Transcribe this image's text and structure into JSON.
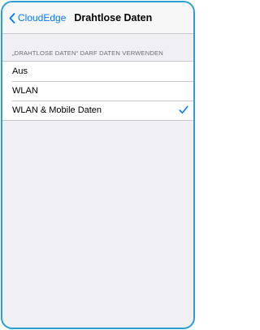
{
  "nav": {
    "back_label": "CloudEdge",
    "title": "Drahtlose Daten"
  },
  "section": {
    "header": "„DRAHTLOSE DATEN“ DARF DATEN VERWENDEN"
  },
  "options": [
    {
      "label": "Aus",
      "selected": false
    },
    {
      "label": "WLAN",
      "selected": false
    },
    {
      "label": "WLAN & Mobile Daten",
      "selected": true
    }
  ],
  "colors": {
    "accent": "#007aff",
    "frame": "#2a9fd6",
    "grouped_background": "#efeff4"
  },
  "icons": {
    "back": "chevron-left-icon",
    "check": "checkmark-icon"
  }
}
